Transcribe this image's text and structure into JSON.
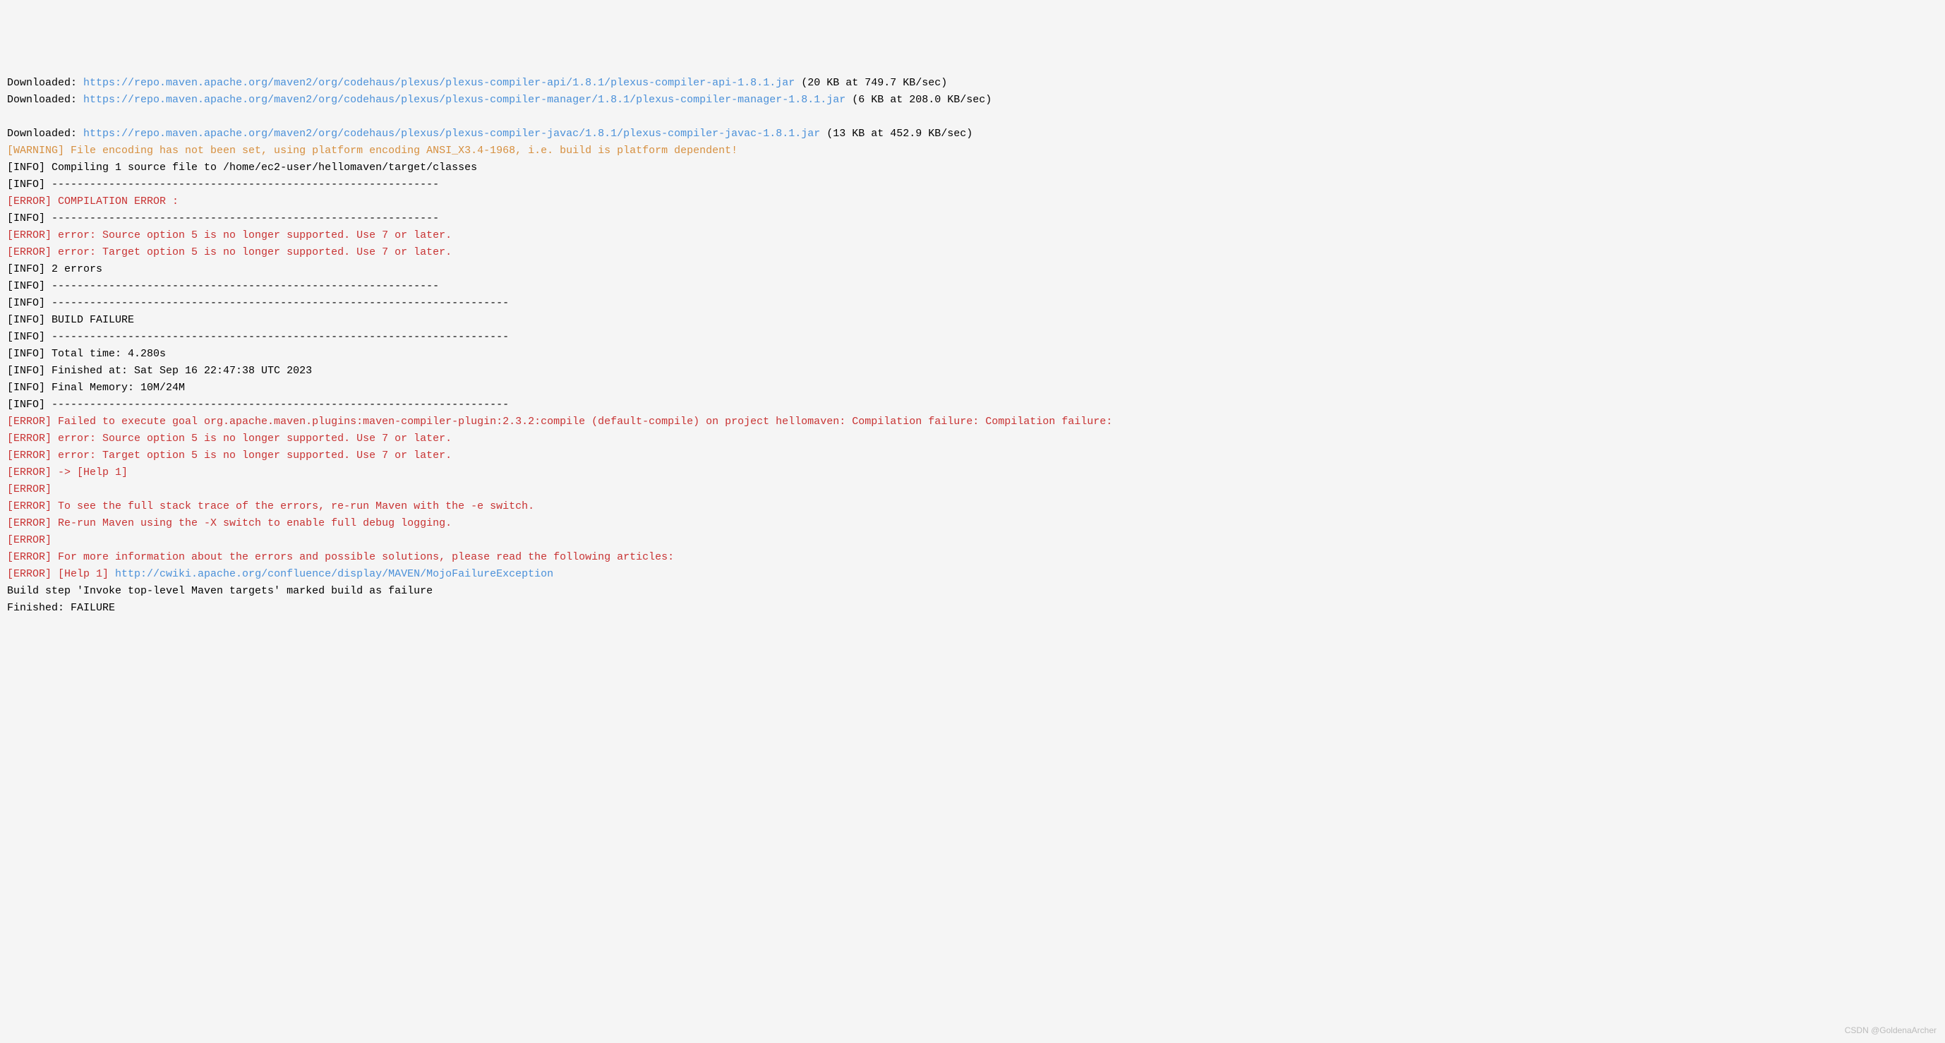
{
  "lines": [
    {
      "segments": [
        {
          "type": "default",
          "text": "Downloaded: "
        },
        {
          "type": "link",
          "text": "https://repo.maven.apache.org/maven2/org/codehaus/plexus/plexus-compiler-api/1.8.1/plexus-compiler-api-1.8.1.jar"
        },
        {
          "type": "default",
          "text": " (20 KB at 749.7 KB/sec)"
        }
      ]
    },
    {
      "segments": [
        {
          "type": "default",
          "text": "Downloaded: "
        },
        {
          "type": "link",
          "text": "https://repo.maven.apache.org/maven2/org/codehaus/plexus/plexus-compiler-manager/1.8.1/plexus-compiler-manager-1.8.1.jar"
        },
        {
          "type": "default",
          "text": " (6 KB at 208.0 KB/sec)"
        }
      ]
    },
    {
      "segments": [
        {
          "type": "default",
          "text": " "
        }
      ]
    },
    {
      "segments": [
        {
          "type": "default",
          "text": "Downloaded: "
        },
        {
          "type": "link",
          "text": "https://repo.maven.apache.org/maven2/org/codehaus/plexus/plexus-compiler-javac/1.8.1/plexus-compiler-javac-1.8.1.jar"
        },
        {
          "type": "default",
          "text": " (13 KB at 452.9 KB/sec)"
        }
      ]
    },
    {
      "segments": [
        {
          "type": "warning",
          "text": "[WARNING] File encoding has not been set, using platform encoding ANSI_X3.4-1968, i.e. build is platform dependent!"
        }
      ]
    },
    {
      "segments": [
        {
          "type": "default",
          "text": "[INFO] Compiling 1 source file to /home/ec2-user/hellomaven/target/classes"
        }
      ]
    },
    {
      "segments": [
        {
          "type": "default",
          "text": "[INFO] -------------------------------------------------------------"
        }
      ]
    },
    {
      "segments": [
        {
          "type": "error",
          "text": "[ERROR] COMPILATION ERROR : "
        }
      ]
    },
    {
      "segments": [
        {
          "type": "default",
          "text": "[INFO] -------------------------------------------------------------"
        }
      ]
    },
    {
      "segments": [
        {
          "type": "error",
          "text": "[ERROR] error: Source option 5 is no longer supported. Use 7 or later."
        }
      ]
    },
    {
      "segments": [
        {
          "type": "error",
          "text": "[ERROR] error: Target option 5 is no longer supported. Use 7 or later."
        }
      ]
    },
    {
      "segments": [
        {
          "type": "default",
          "text": "[INFO] 2 errors "
        }
      ]
    },
    {
      "segments": [
        {
          "type": "default",
          "text": "[INFO] -------------------------------------------------------------"
        }
      ]
    },
    {
      "segments": [
        {
          "type": "default",
          "text": "[INFO] ------------------------------------------------------------------------"
        }
      ]
    },
    {
      "segments": [
        {
          "type": "default",
          "text": "[INFO] BUILD FAILURE"
        }
      ]
    },
    {
      "segments": [
        {
          "type": "default",
          "text": "[INFO] ------------------------------------------------------------------------"
        }
      ]
    },
    {
      "segments": [
        {
          "type": "default",
          "text": "[INFO] Total time: 4.280s"
        }
      ]
    },
    {
      "segments": [
        {
          "type": "default",
          "text": "[INFO] Finished at: Sat Sep 16 22:47:38 UTC 2023"
        }
      ]
    },
    {
      "segments": [
        {
          "type": "default",
          "text": "[INFO] Final Memory: 10M/24M"
        }
      ]
    },
    {
      "segments": [
        {
          "type": "default",
          "text": "[INFO] ------------------------------------------------------------------------"
        }
      ]
    },
    {
      "segments": [
        {
          "type": "error",
          "text": "[ERROR] Failed to execute goal org.apache.maven.plugins:maven-compiler-plugin:2.3.2:compile (default-compile) on project hellomaven: Compilation failure: Compilation failure:"
        }
      ]
    },
    {
      "segments": [
        {
          "type": "error",
          "text": "[ERROR] error: Source option 5 is no longer supported. Use 7 or later."
        }
      ]
    },
    {
      "segments": [
        {
          "type": "error",
          "text": "[ERROR] error: Target option 5 is no longer supported. Use 7 or later."
        }
      ]
    },
    {
      "segments": [
        {
          "type": "error",
          "text": "[ERROR] -> [Help 1]"
        }
      ]
    },
    {
      "segments": [
        {
          "type": "error",
          "text": "[ERROR] "
        }
      ]
    },
    {
      "segments": [
        {
          "type": "error",
          "text": "[ERROR] To see the full stack trace of the errors, re-run Maven with the -e switch."
        }
      ]
    },
    {
      "segments": [
        {
          "type": "error",
          "text": "[ERROR] Re-run Maven using the -X switch to enable full debug logging."
        }
      ]
    },
    {
      "segments": [
        {
          "type": "error",
          "text": "[ERROR] "
        }
      ]
    },
    {
      "segments": [
        {
          "type": "error",
          "text": "[ERROR] For more information about the errors and possible solutions, please read the following articles:"
        }
      ]
    },
    {
      "segments": [
        {
          "type": "error",
          "text": "[ERROR] [Help 1] "
        },
        {
          "type": "link",
          "text": "http://cwiki.apache.org/confluence/display/MAVEN/MojoFailureException"
        }
      ]
    },
    {
      "segments": [
        {
          "type": "default",
          "text": "Build step 'Invoke top-level Maven targets' marked build as failure"
        }
      ]
    },
    {
      "segments": [
        {
          "type": "default",
          "text": "Finished: FAILURE"
        }
      ]
    }
  ],
  "watermark": "CSDN @GoldenaArcher"
}
